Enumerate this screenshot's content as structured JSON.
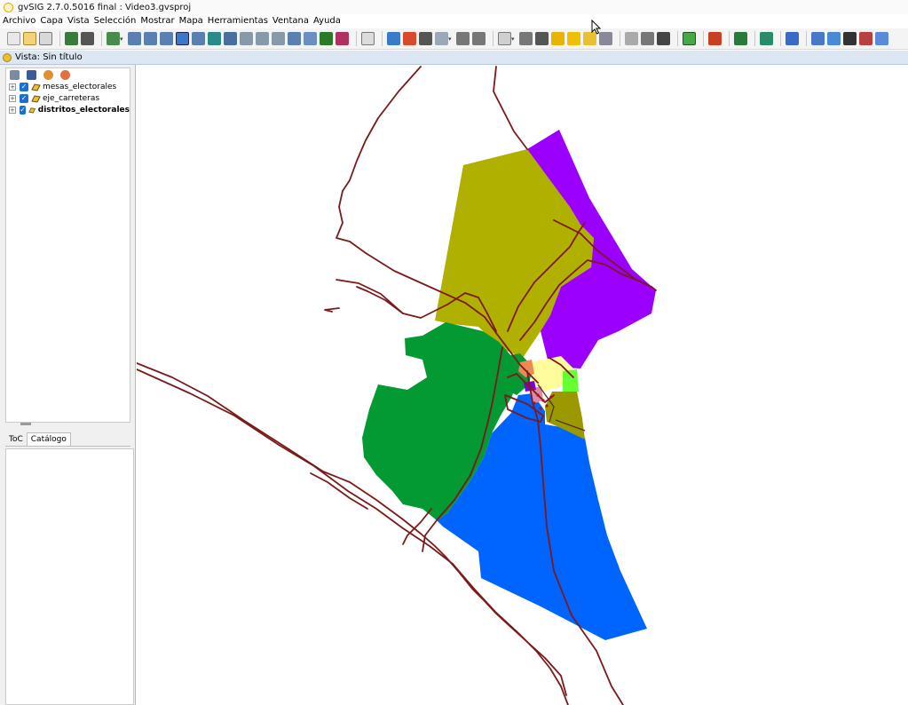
{
  "window": {
    "title": "gvSIG 2.7.0.5016 final : Video3.gvsproj"
  },
  "menu": [
    "Archivo",
    "Capa",
    "Vista",
    "Selección",
    "Mostrar",
    "Mapa",
    "Herramientas",
    "Ventana",
    "Ayuda"
  ],
  "toolbar": {
    "icons": [
      "new-project-icon",
      "open-project-icon",
      "save-project-icon",
      "print-icon",
      "pan-icon",
      "zoom-in-icon",
      "zoom-out-icon",
      "zoom-all-icon",
      "measure-distance-icon",
      "info-icon",
      "select-icon",
      "edit-icon",
      "layer-add-icon",
      "settings-icon"
    ]
  },
  "view": {
    "title": "Vista: Sin título"
  },
  "toc": {
    "layers": [
      {
        "name": "mesas_electorales",
        "checked": true,
        "bold": false
      },
      {
        "name": "eje_carreteras",
        "checked": true,
        "bold": false
      },
      {
        "name": "distritos_electorales",
        "checked": true,
        "bold": true
      }
    ]
  },
  "tabs": {
    "toc": "ToC",
    "catalog": "Catálogo"
  },
  "map": {
    "road_color": "#7b1a1a",
    "district_colors": {
      "olive": "#b0b000",
      "purple": "#9b00ff",
      "green": "#039a34",
      "blue": "#0064ff",
      "dark_olive": "#9a9a00",
      "light_yellow": "#fffc99",
      "lime": "#66ff33",
      "orange": "#ee8855"
    }
  }
}
